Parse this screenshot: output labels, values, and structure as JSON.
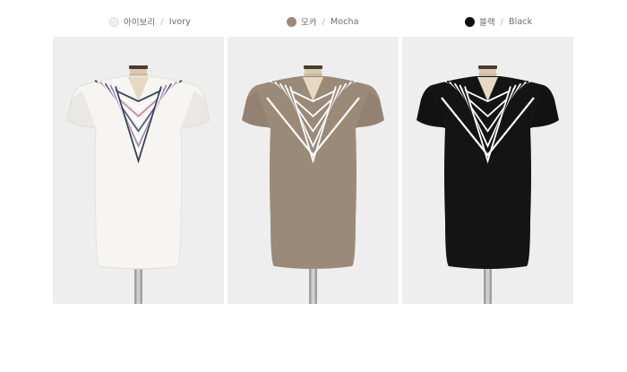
{
  "colors": [
    {
      "id": "ivory",
      "korean": "아이보리",
      "english": "Ivory",
      "dot_hex": "#eeeeee",
      "garment_hex": "#f6f5f2",
      "stripes": [
        "#3a4458",
        "#ffffff",
        "#c08ea2",
        "#ffffff",
        "#50607e",
        "#ffffff",
        "#a68bb6",
        "#ffffff",
        "#3a4458"
      ]
    },
    {
      "id": "mocha",
      "korean": "모카",
      "english": "Mocha",
      "dot_hex": "#9d8b79",
      "garment_hex": "#9b8a78",
      "stripes": [
        "#ffffff",
        "#9b8a78",
        "#ffffff",
        "#9b8a78",
        "#ffffff",
        "#9b8a78",
        "#ffffff",
        "#9b8a78",
        "#ffffff"
      ]
    },
    {
      "id": "black",
      "korean": "블랙",
      "english": "Black",
      "dot_hex": "#0c0c0c",
      "garment_hex": "#141414",
      "stripes": [
        "#ffffff",
        "#141414",
        "#ffffff",
        "#141414",
        "#ffffff",
        "#141414",
        "#ffffff",
        "#141414",
        "#ffffff"
      ]
    }
  ],
  "separator": "/",
  "backdrop_hex": "#eeeeee"
}
